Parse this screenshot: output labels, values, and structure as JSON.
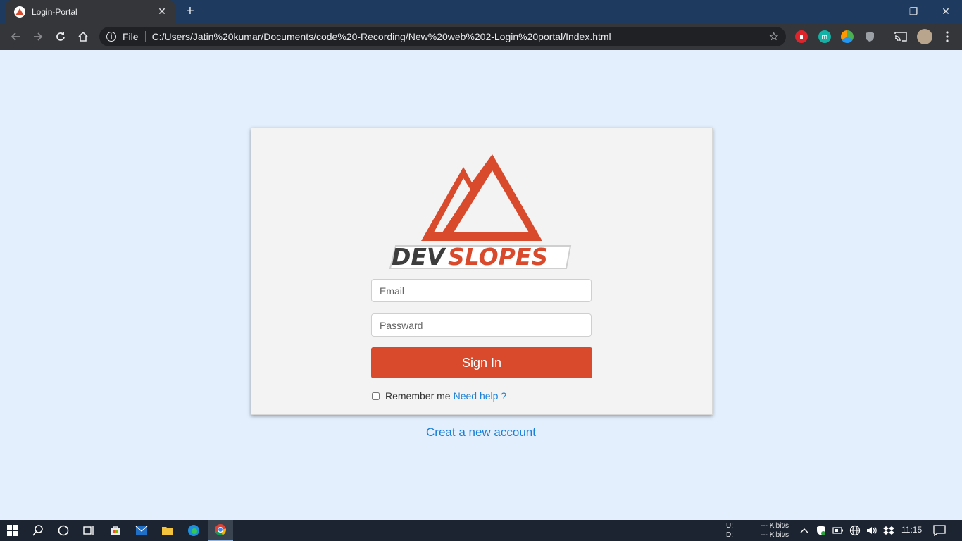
{
  "browser": {
    "tab_title": "Login-Portal",
    "tab_close": "✕",
    "new_tab": "+",
    "window_controls": {
      "minimize": "—",
      "restore": "❐",
      "close": "✕"
    },
    "omnibox": {
      "scheme_label": "File",
      "url": "C:/Users/Jatin%20kumar/Documents/code%20-Recording/New%20web%202-Login%20portal/Index.html"
    },
    "extensions": [
      {
        "icon": "adblock-icon",
        "color": "#e0242b"
      },
      {
        "icon": "m-extension-icon",
        "color": "#12b3a6",
        "label": "m"
      },
      {
        "icon": "colorful-extension-icon",
        "color": "#4caf50"
      },
      {
        "icon": "shield-extension-icon",
        "color": "#9aa0a6"
      }
    ]
  },
  "login": {
    "brand_part1": "DEV",
    "brand_part2": "SLOPES",
    "email_placeholder": "Email",
    "password_placeholder": "Passward",
    "signin_label": "Sign In",
    "remember_label": "Remember me",
    "help_link": "Need help ?",
    "create_account": "Creat a new account"
  },
  "colors": {
    "accent": "#d9492b",
    "link": "#1a7fd6",
    "page_bg": "#e3effd",
    "card_bg": "#f3f3f3"
  },
  "taskbar": {
    "net_up_label": "U:",
    "net_down_label": "D:",
    "net_up_value": "--- Kibit/s",
    "net_down_value": "--- Kibit/s",
    "time": "11:15"
  }
}
